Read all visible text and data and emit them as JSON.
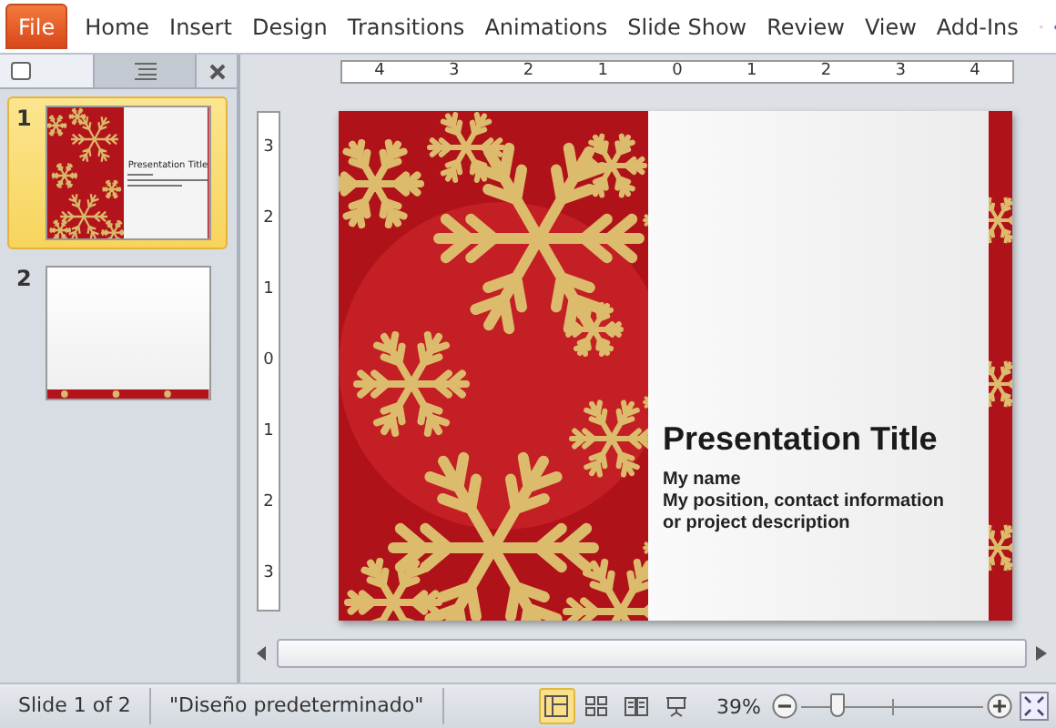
{
  "ribbon": {
    "file_label": "File",
    "tabs": [
      "Home",
      "Insert",
      "Design",
      "Transitions",
      "Animations",
      "Slide Show",
      "Review",
      "View",
      "Add-Ins"
    ]
  },
  "pane_tabs": [
    {
      "kind": "slides",
      "selected": true
    },
    {
      "kind": "outline",
      "selected": false
    }
  ],
  "thumbnails": [
    {
      "number": "1",
      "selected": true,
      "kind": "title",
      "title": "Presentation Title"
    },
    {
      "number": "2",
      "selected": false,
      "kind": "blank"
    }
  ],
  "ruler": {
    "horizontal": [
      "4",
      "3",
      "2",
      "1",
      "0",
      "1",
      "2",
      "3",
      "4"
    ],
    "vertical": [
      "3",
      "2",
      "1",
      "0",
      "1",
      "2",
      "3"
    ]
  },
  "slide": {
    "title": "Presentation Title",
    "subtitle_lines": [
      "My name",
      "My position, contact information",
      "or project description"
    ]
  },
  "status_bar": {
    "slide_info": "Slide 1 of 2",
    "theme": "\"Diseño predeterminado\"",
    "views": [
      {
        "kind": "normal",
        "selected": true
      },
      {
        "kind": "sorter",
        "selected": false
      },
      {
        "kind": "reading",
        "selected": false
      },
      {
        "kind": "show",
        "selected": false
      }
    ],
    "zoom": "39%",
    "zoom_slider": {
      "level": 0.2
    }
  }
}
